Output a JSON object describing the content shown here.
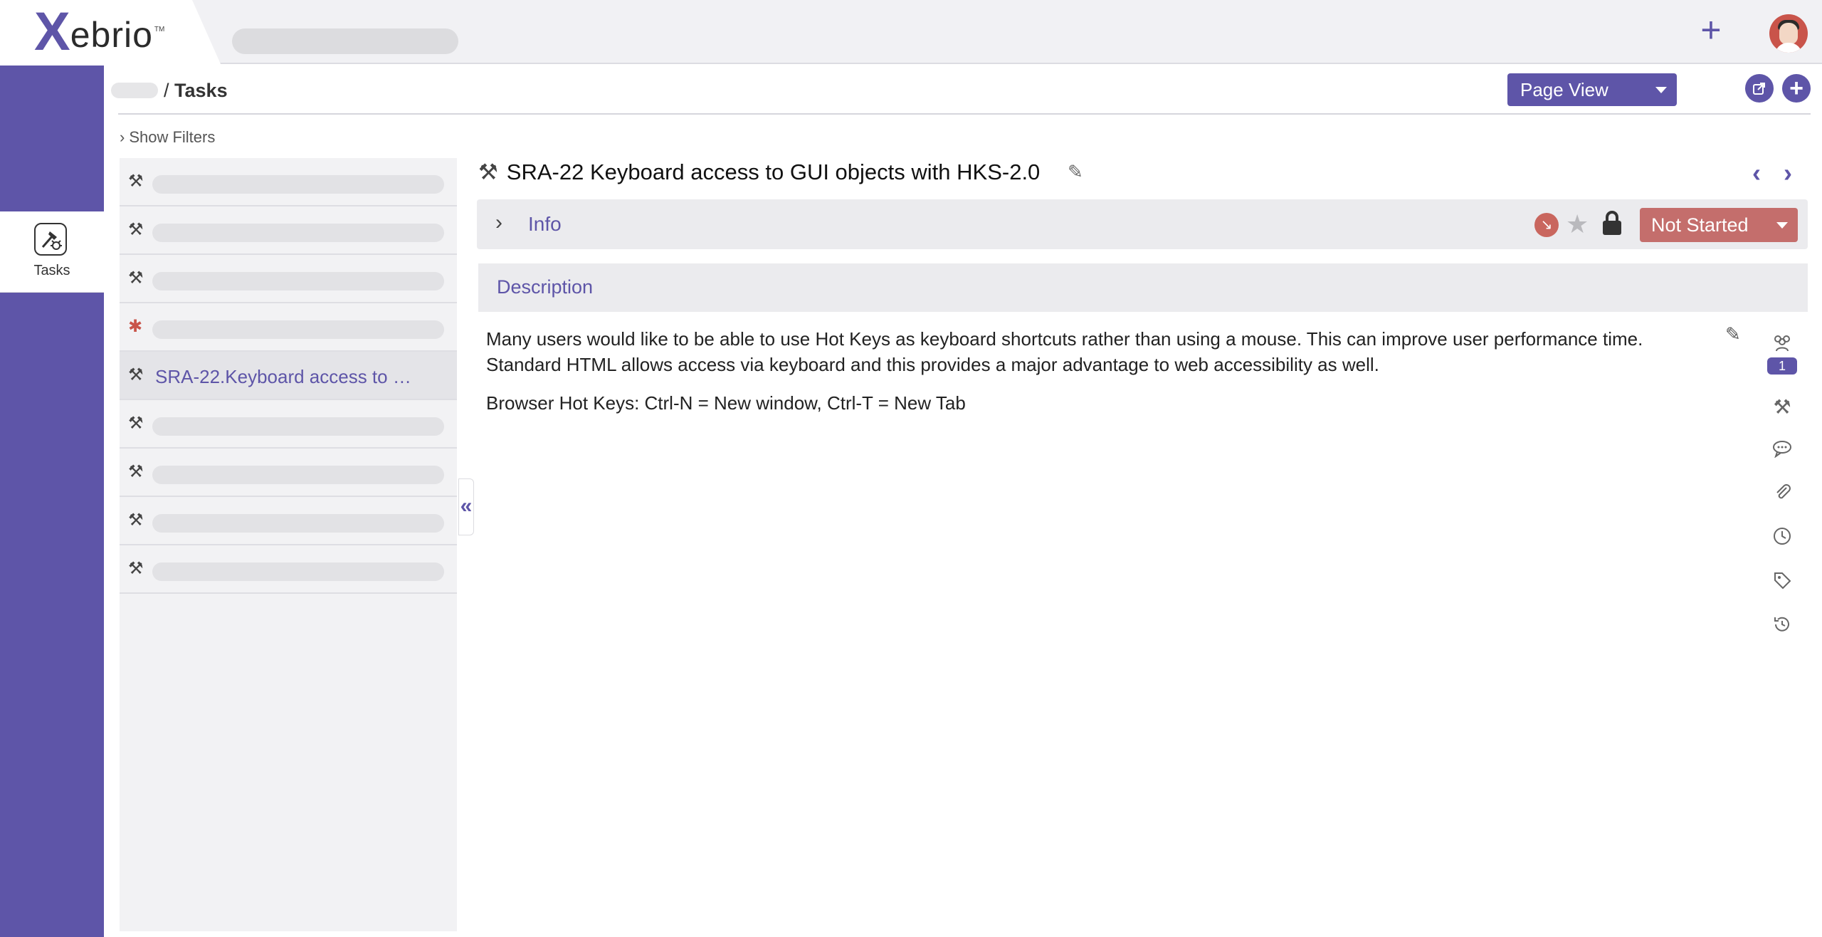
{
  "app": {
    "logo_x": "X",
    "logo_rest": "ebrio",
    "logo_tm": "TM"
  },
  "topbar": {
    "add_icon": "+",
    "add_name": "plus-icon"
  },
  "sidebar": {
    "items": [
      {
        "label": "Tasks",
        "icon": "tasks-icon"
      }
    ]
  },
  "header": {
    "breadcrumb_sep": "/",
    "breadcrumb_current": "Tasks",
    "view_selector": "Page View"
  },
  "filters": {
    "toggle_label": "Show Filters"
  },
  "task_list": {
    "selected_label": "SRA-22.Keyboard access to …",
    "rows": [
      {
        "icon": "hammer-icon",
        "type": "task"
      },
      {
        "icon": "hammer-icon",
        "type": "task"
      },
      {
        "icon": "hammer-icon",
        "type": "task"
      },
      {
        "icon": "bug-icon",
        "type": "bug"
      },
      {
        "icon": "hammer-icon",
        "type": "task",
        "selected": true
      },
      {
        "icon": "hammer-icon",
        "type": "task"
      },
      {
        "icon": "hammer-icon",
        "type": "task"
      },
      {
        "icon": "hammer-icon",
        "type": "task"
      },
      {
        "icon": "hammer-icon",
        "type": "task"
      }
    ]
  },
  "detail": {
    "title": "SRA-22 Keyboard access to GUI objects with HKS-2.0",
    "info_label": "Info",
    "status": "Not Started",
    "description_header": "Description",
    "description_paragraphs": [
      "Many users would like to be able to use Hot Keys as keyboard shortcuts rather than using a mouse. This can improve user performance time. Standard HTML allows access via keyboard and this provides a major advantage to web accessibility as well.",
      "Browser Hot Keys: Ctrl-N = New window, Ctrl-T = New Tab"
    ]
  },
  "rail": {
    "followers_count": "1",
    "icons": [
      "users-icon",
      "hammer-icon",
      "comments-icon",
      "paperclip-icon",
      "clock-icon",
      "tag-icon",
      "history-icon"
    ]
  },
  "colors": {
    "brand": "#5e55a8",
    "status": "#c46e6c",
    "priority": "#c9665e"
  }
}
